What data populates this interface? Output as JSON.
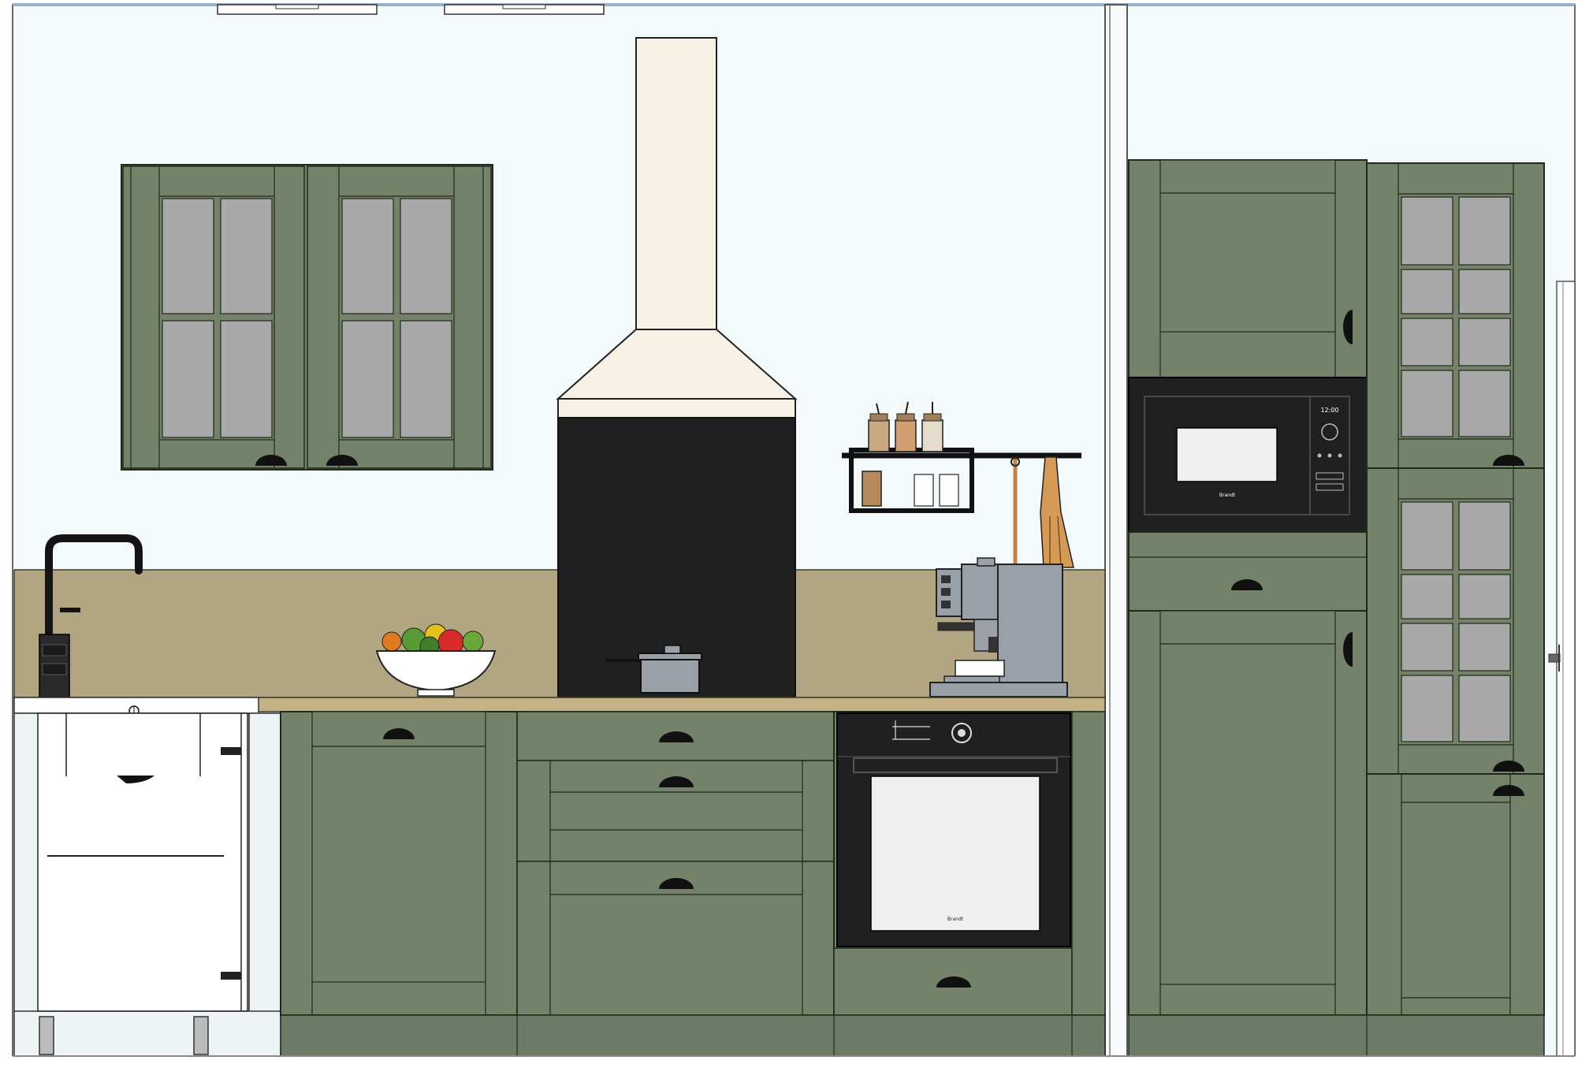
{
  "scene": {
    "kind": "kitchen-elevation",
    "colors": {
      "wall": "#f4f9fc",
      "cabinet": "#738269",
      "cabinet_dark": "#5f6d57",
      "outline": "#1f2a1c",
      "backsplash": "#b2a581",
      "countertop": "#c5b186",
      "plinth": "#6d7a66",
      "hood": "#f6f1e4",
      "appliance_black": "#202020",
      "glass": "#a9a9a9",
      "dishwasher": "#eef3f6"
    }
  },
  "labels": {
    "microwave_brand": "Brandt",
    "oven_brand": "Brandt",
    "microwave_display": "12:00"
  }
}
